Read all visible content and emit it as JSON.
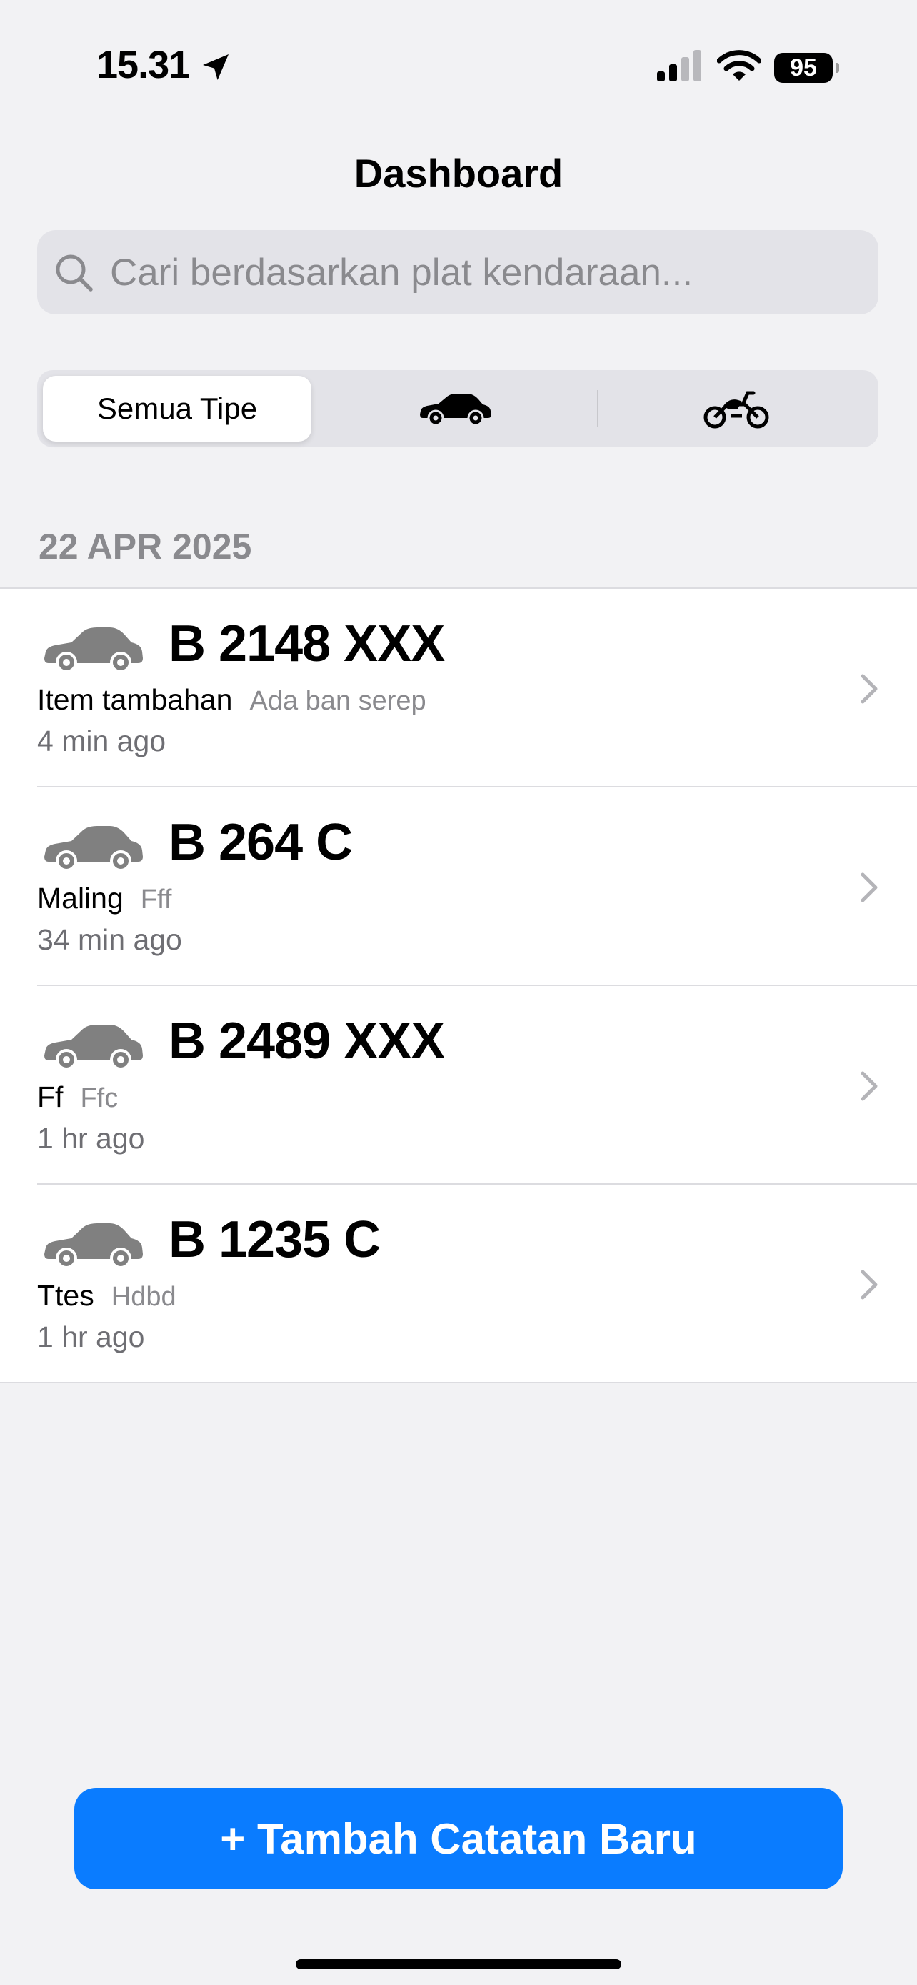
{
  "status_bar": {
    "time": "15.31",
    "battery_level": "95",
    "icons": [
      "location-arrow-icon",
      "cellular-signal-icon",
      "wifi-icon",
      "battery-icon"
    ]
  },
  "header": {
    "title": "Dashboard"
  },
  "search": {
    "placeholder": "Cari berdasarkan plat kendaraan...",
    "value": "",
    "icon": "magnifying-glass-icon"
  },
  "filter": {
    "segments": [
      {
        "label": "Semua Tipe",
        "icon": null,
        "selected": true
      },
      {
        "label": "",
        "icon": "car-icon",
        "selected": false
      },
      {
        "label": "",
        "icon": "motorcycle-icon",
        "selected": false
      }
    ]
  },
  "section": {
    "date": "22 APR 2025"
  },
  "records": [
    {
      "plate": "B 2148 XXX",
      "title": "Item tambahan",
      "note": "Ada ban serep",
      "time": "4 min ago",
      "vehicle_icon": "car-icon"
    },
    {
      "plate": "B 264 C",
      "title": "Maling",
      "note": "Fff",
      "time": "34 min ago",
      "vehicle_icon": "car-icon"
    },
    {
      "plate": "B 2489 XXX",
      "title": "Ff",
      "note": "Ffc",
      "time": "1 hr ago",
      "vehicle_icon": "car-icon"
    },
    {
      "plate": "B 1235 C",
      "title": "Ttes",
      "note": "Hdbd",
      "time": "1 hr ago",
      "vehicle_icon": "car-icon"
    }
  ],
  "footer": {
    "add_button_label": "+ Tambah Catatan Baru"
  },
  "colors": {
    "accent": "#0a7cff",
    "background": "#f2f2f4",
    "secondary_text": "#8a8a8e",
    "vehicle_icon": "#808080"
  }
}
